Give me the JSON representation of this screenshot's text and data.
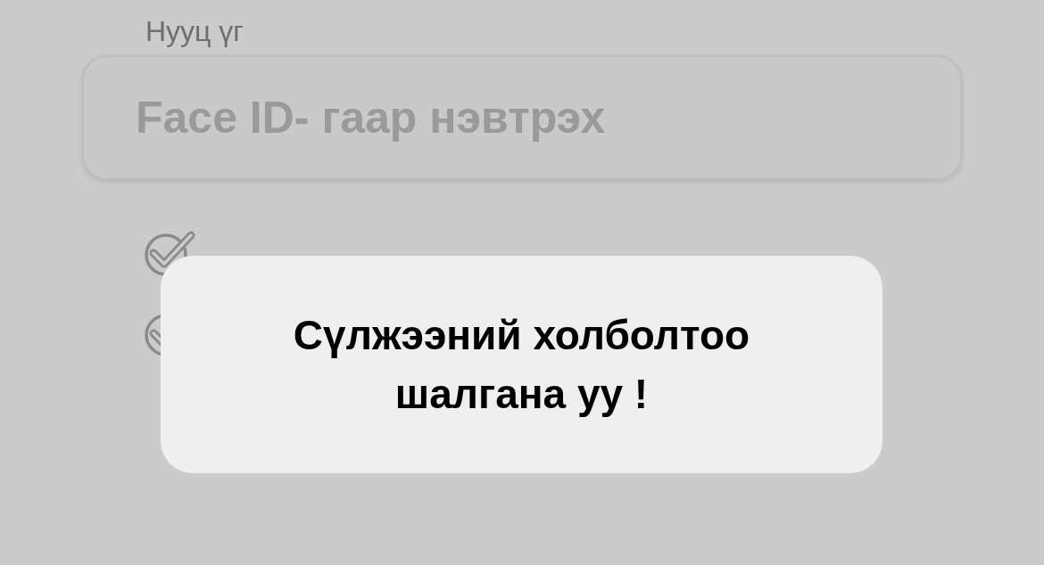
{
  "password_label": "Нууц үг",
  "face_id_button": {
    "label": "Face ID- гаар нэвтрэх"
  },
  "options": [
    {
      "checked": true
    },
    {
      "checked": true
    }
  ],
  "toast": {
    "message": "Сүлжээний холболтоо шалгана уу !"
  }
}
